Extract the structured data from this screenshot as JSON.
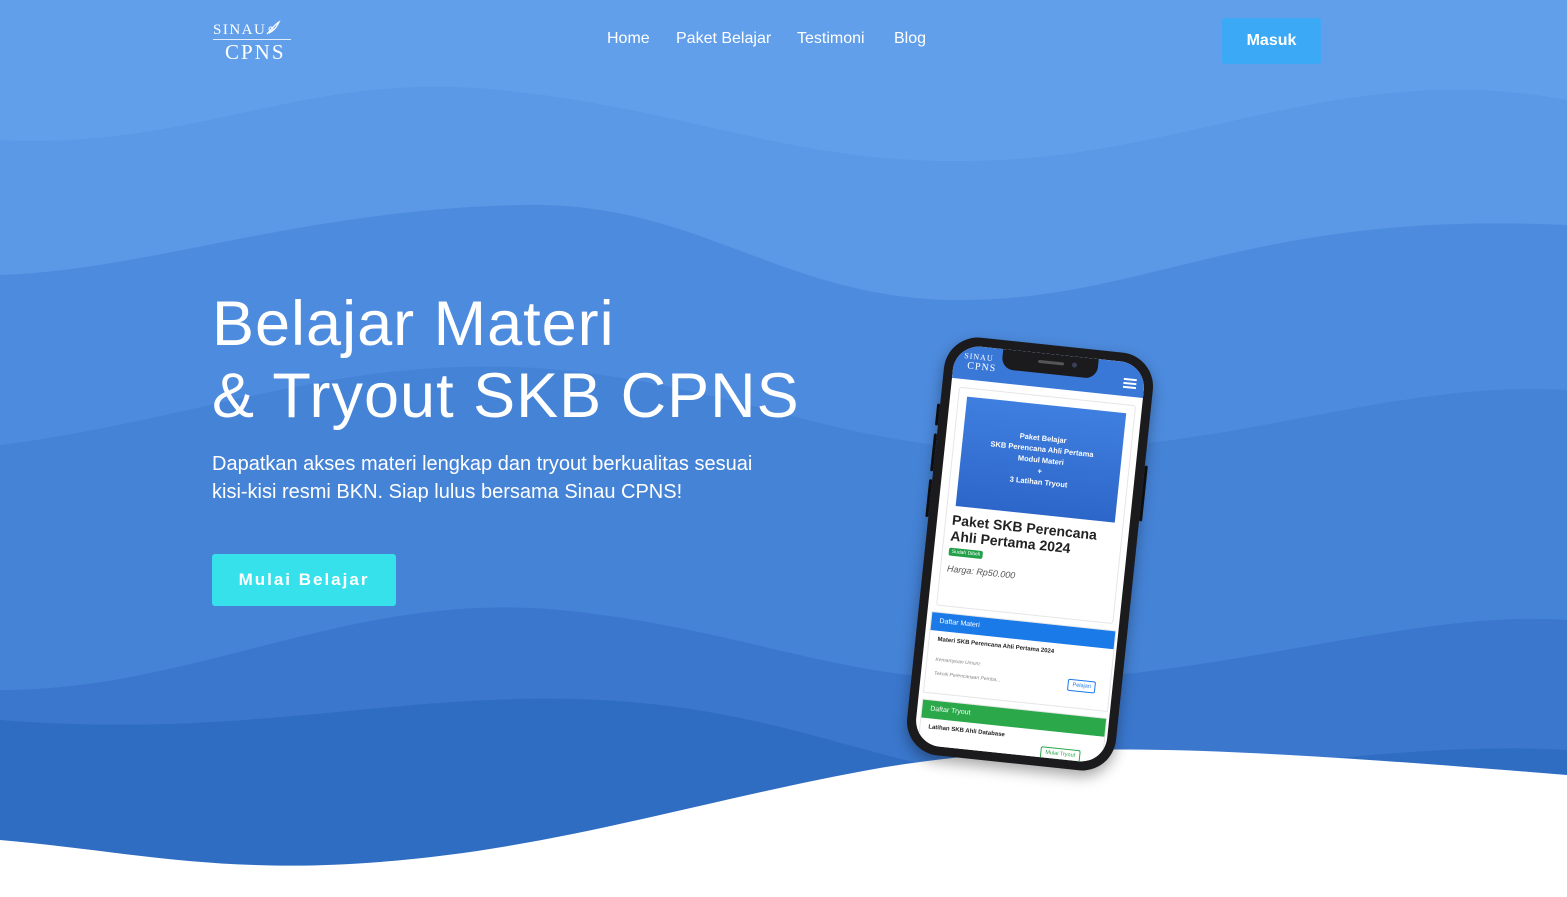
{
  "brand": {
    "logo_top": "SINAU",
    "logo_bottom": "CPNS"
  },
  "nav": {
    "items": [
      "Home",
      "Paket Belajar",
      "Testimoni",
      "Blog"
    ],
    "login_label": "Masuk"
  },
  "hero": {
    "title_line1": "Belajar Materi",
    "title_line2": "& Tryout SKB CPNS",
    "subtitle_line1": "Dapatkan akses materi lengkap dan tryout berkualitas sesuai",
    "subtitle_line2": "kisi-kisi resmi BKN. Siap lulus bersama Sinau CPNS!",
    "cta_label": "Mulai Belajar"
  },
  "phone_screen": {
    "logo_top": "SINAU",
    "logo_bottom": "CPNS",
    "banner_lines": [
      "Paket Belajar",
      "SKB Perencana Ahli Pertama",
      "Modul Materi",
      "+",
      "3 Latihan Tryout"
    ],
    "package_title": "Paket SKB Perencana Ahli Pertama 2024",
    "badge": "Sudah Dibeli",
    "price": "Harga: Rp50.000",
    "materi_header": "Daftar Materi",
    "materi_item_title": "Materi SKB Perencana Ahli Pertama 2024",
    "materi_item_sub1": "Kemampuan Umum:",
    "materi_item_sub2": "Teknik Perencanaan Pemba...",
    "materi_button": "Pelajari",
    "tryout_header": "Daftar Tryout",
    "tryout_item_title": "Latihan SKB Ahli Database",
    "tryout_button": "Mulai Tryout"
  },
  "colors": {
    "wave_light": "#629fea",
    "wave_mid": "#4a88db",
    "wave_dark": "#2f6dc3",
    "login_button": "#3ba9f5",
    "cta_button": "#37e1ec"
  }
}
